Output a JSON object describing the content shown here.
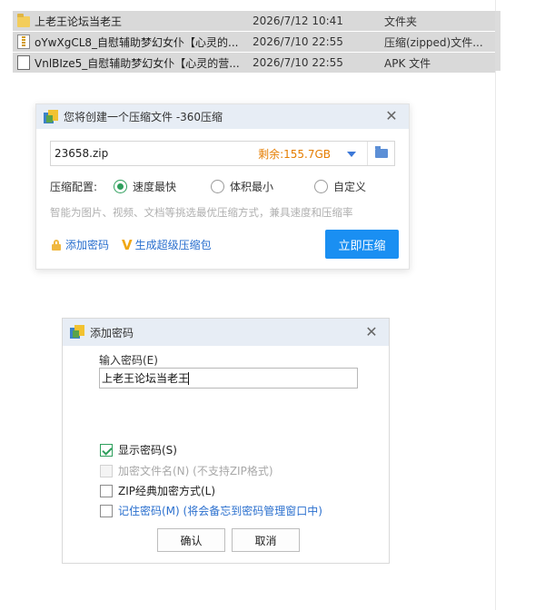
{
  "file_list": {
    "rows": [
      {
        "icon": "folder-icon",
        "name": "上老王论坛当老王",
        "date": "2026/7/12 10:41",
        "type": "文件夹"
      },
      {
        "icon": "zip-file-icon",
        "name": "oYwXgCL8_自慰辅助梦幻女仆【心灵的...",
        "date": "2026/7/10 22:55",
        "type": "压缩(zipped)文件..."
      },
      {
        "icon": "apk-file-icon",
        "name": "VnlBIze5_自慰辅助梦幻女仆【心灵的营...",
        "date": "2026/7/10 22:55",
        "type": "APK 文件"
      }
    ]
  },
  "compress_dialog": {
    "title": "您将创建一个压缩文件 -360压缩",
    "filename": "23658.zip",
    "remaining_space": "剩余:155.7GB",
    "config_label": "压缩配置:",
    "options": [
      "速度最快",
      "体积最小",
      "自定义"
    ],
    "selected_option": "速度最快",
    "hint": "智能为图片、视频、文档等挑选最优压缩方式，兼具速度和压缩率",
    "add_password_link": "添加密码",
    "super_pack_link": "生成超级压缩包",
    "compress_now_button": "立即压缩",
    "accent_color": "#1a8ff2",
    "remaining_color": "#e57d00"
  },
  "password_dialog": {
    "title": "添加密码",
    "input_label": "输入密码(E)",
    "password_value": "上老王论坛当老王",
    "checkboxes": [
      {
        "label": "显示密码(S)",
        "checked": true,
        "enabled": true
      },
      {
        "label": "加密文件名(N) (不支持ZIP格式)",
        "checked": false,
        "enabled": false
      },
      {
        "label": "ZIP经典加密方式(L)",
        "checked": false,
        "enabled": true
      },
      {
        "label": "记住密码(M) (将会备忘到密码管理窗口中)",
        "checked": false,
        "enabled": true
      }
    ],
    "ok_button": "确认",
    "cancel_button": "取消"
  }
}
